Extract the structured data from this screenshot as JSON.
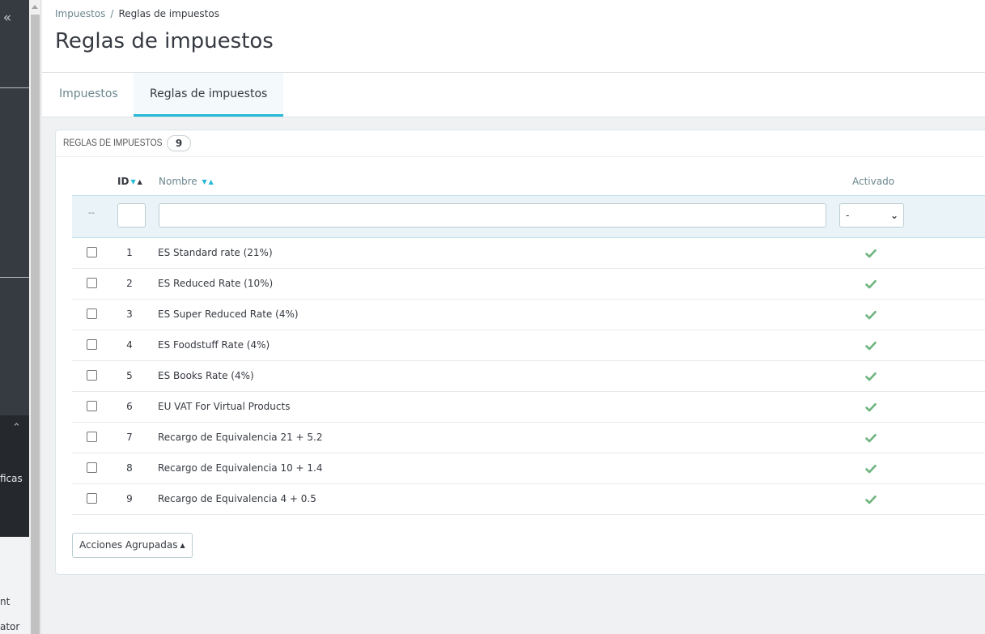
{
  "sidebar": {
    "collapse_glyph": "«",
    "partial_label_1": "ficas",
    "partial_label_2": "nt",
    "partial_label_3": "ator"
  },
  "breadcrumb": {
    "parent": "Impuestos",
    "separator": "/",
    "current": "Reglas de impuestos"
  },
  "page_title": "Reglas de impuestos",
  "tabs": [
    {
      "label": "Impuestos",
      "active": false
    },
    {
      "label": "Reglas de impuestos",
      "active": true
    }
  ],
  "panel": {
    "title": "Reglas de impuestos",
    "count": "9"
  },
  "columns": {
    "id": "ID",
    "name": "Nombre",
    "active": "Activado"
  },
  "filters": {
    "bulk_placeholder": "--",
    "id_value": "",
    "name_value": "",
    "active_value": "-"
  },
  "rows": [
    {
      "id": "1",
      "name": "ES Standard rate (21%)",
      "active": true
    },
    {
      "id": "2",
      "name": "ES Reduced Rate (10%)",
      "active": true
    },
    {
      "id": "3",
      "name": "ES Super Reduced Rate (4%)",
      "active": true
    },
    {
      "id": "4",
      "name": "ES Foodstuff Rate (4%)",
      "active": true
    },
    {
      "id": "5",
      "name": "ES Books Rate (4%)",
      "active": true
    },
    {
      "id": "6",
      "name": "EU VAT For Virtual Products",
      "active": true
    },
    {
      "id": "7",
      "name": "Recargo de Equivalencia 21 + 5.2",
      "active": true
    },
    {
      "id": "8",
      "name": "Recargo de Equivalencia 10 + 1.4",
      "active": true
    },
    {
      "id": "9",
      "name": "Recargo de Equivalencia 4 + 0.5",
      "active": true
    }
  ],
  "bulk_actions": {
    "label": "Acciones Agrupadas"
  },
  "colors": {
    "accent": "#25b9d7",
    "check": "#70b580",
    "sidebar": "#363a41"
  },
  "icons": {
    "sort_desc": "sort-desc-icon",
    "sort_asc": "sort-asc-icon",
    "check": "check-icon",
    "caret_up": "caret-up-icon",
    "chevron_down": "chevron-down-icon"
  }
}
